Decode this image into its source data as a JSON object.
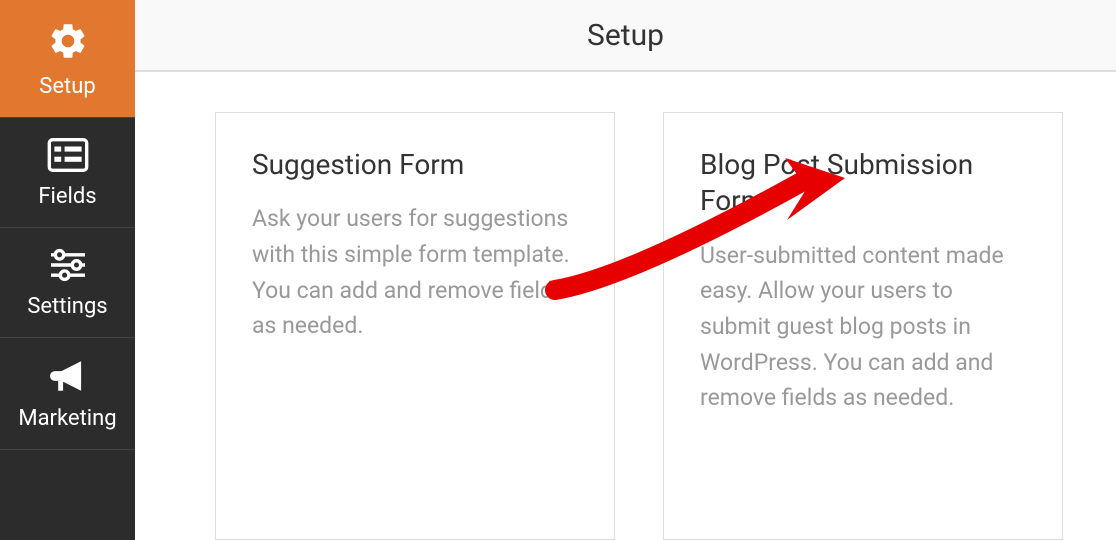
{
  "header": {
    "title": "Setup"
  },
  "sidebar": {
    "items": [
      {
        "label": "Setup"
      },
      {
        "label": "Fields"
      },
      {
        "label": "Settings"
      },
      {
        "label": "Marketing"
      }
    ]
  },
  "cards": [
    {
      "title": "Suggestion Form",
      "description": "Ask your users for suggestions with this simple form template. You can add and remove fields as needed."
    },
    {
      "title": "Blog Post Submission Form",
      "description": "User-submitted content made easy. Allow your users to submit guest blog posts in WordPress. You can add and remove fields as needed."
    }
  ],
  "colors": {
    "accent": "#e27730",
    "sidebar": "#2c2c2c",
    "arrow": "#e60000"
  }
}
